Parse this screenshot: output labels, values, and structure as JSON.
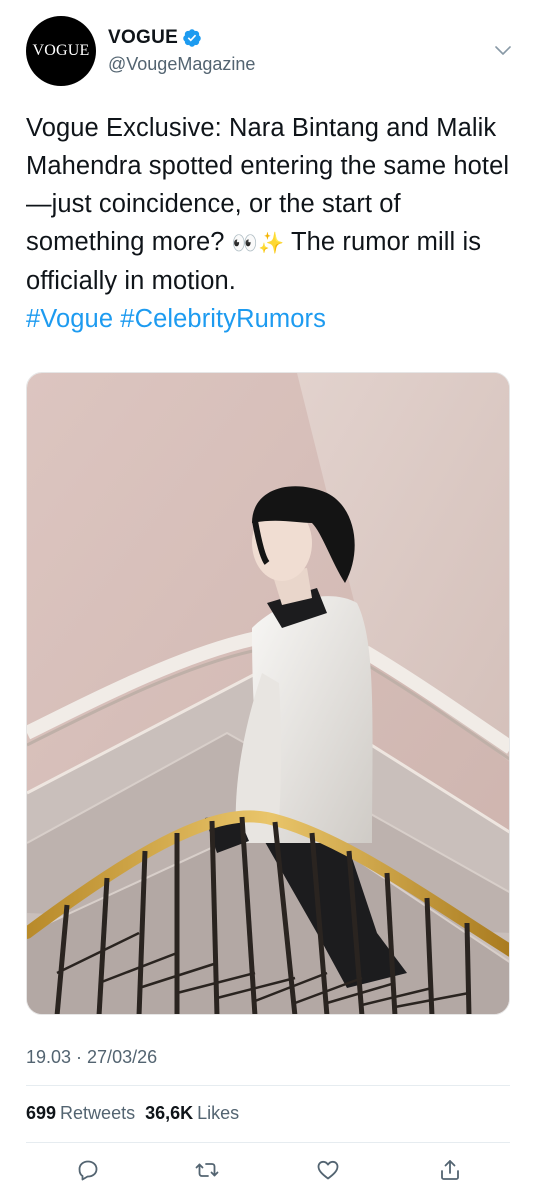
{
  "author": {
    "avatar_text": "VOGUE",
    "display_name": "VOGUE",
    "handle": "@VougeMagazine",
    "verified_icon": "verified-badge-icon",
    "verified_color": "#1d9bf0"
  },
  "tweet": {
    "text_main": "Vogue Exclusive: Nara Bintang and Malik Mahendra spotted entering the same hotel—just coincidence, or the start of something more?",
    "emoji": "👀✨",
    "text_after": "The rumor mill is officially in motion.",
    "hashtags": "#Vogue #CelebrityRumors",
    "link_color": "#1d9bf0"
  },
  "timestamp": "19.03 · 27/03/26",
  "stats": {
    "retweets_count": "699",
    "retweets_label": "Retweets",
    "likes_count": "36,6K",
    "likes_label": "Likes"
  },
  "actions": {
    "reply_icon": "reply-icon",
    "retweet_icon": "retweet-icon",
    "like_icon": "heart-icon",
    "share_icon": "share-icon"
  }
}
